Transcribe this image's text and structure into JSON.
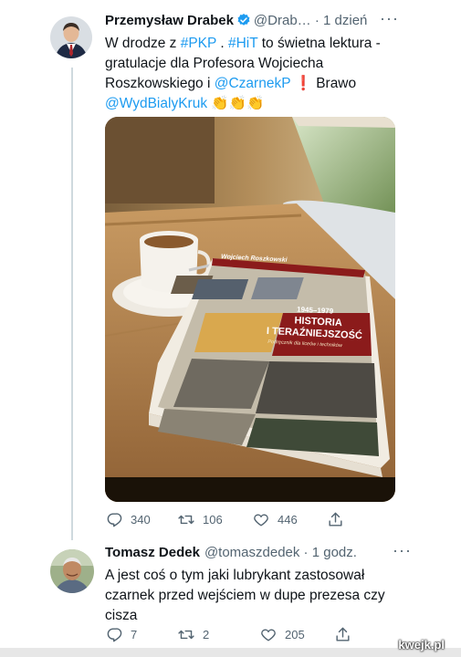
{
  "tweet1": {
    "name": "Przemysław Drabek",
    "handle": "@Drab…",
    "separator": " · ",
    "time": "1 dzień",
    "more": "···",
    "text": {
      "l1_pre": "W drodze z ",
      "l1_tag1": "#PKP",
      "l1_mid": " . ",
      "l1_tag2": "#HiT",
      "l1_post": " to świetna lektura -",
      "l2": "gratulacje dla Profesora Wojciecha",
      "l3_pre": "Roszkowskiego i ",
      "l3_mention": "@CzarnekP",
      "l3_mark": " ❗ ",
      "l3_post": " Brawo",
      "l4_mention": "@WydBialyKruk",
      "l4_emoji": " 👏👏👏"
    },
    "book": {
      "author": "Wojciech Roszkowski",
      "years": "1945–1979",
      "title1": "HISTORIA",
      "title2": "I TERAŹNIEJSZOŚĆ",
      "subtitle": "Podręcznik dla liceów i techników"
    },
    "stats": {
      "replies": "340",
      "retweets": "106",
      "likes": "446"
    }
  },
  "tweet2": {
    "name": "Tomasz Dedek",
    "handle": "@tomaszdedek",
    "separator": " · ",
    "time": "1 godz.",
    "more": "···",
    "lines": [
      "A jest coś o tym jaki lubrykant zastosował",
      "czarnek przed wejściem w  dupe prezesa czy",
      "cisza"
    ],
    "stats": {
      "replies": "7",
      "retweets": "2",
      "likes": "205"
    }
  },
  "watermark": "kwejk.pl",
  "colors": {
    "link": "#1d9bf0",
    "muted": "#536471",
    "verified": "#1d9bf0"
  }
}
